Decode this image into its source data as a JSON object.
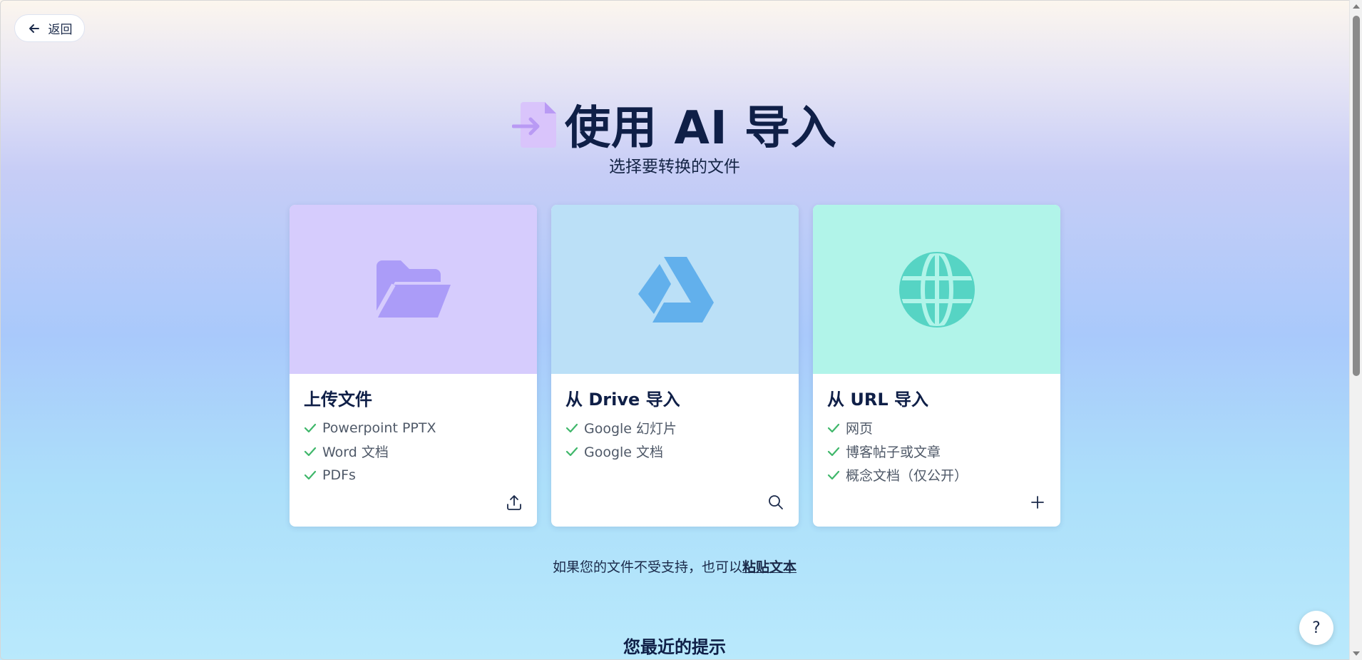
{
  "back": {
    "label": "返回"
  },
  "hero": {
    "title": "使用 AI 导入",
    "subtitle": "选择要转换的文件"
  },
  "cards": [
    {
      "title": "上传文件",
      "bg": "#d6ccfd",
      "icon_color": "#ab9cf8",
      "icon": "folder-icon",
      "action_icon": "upload-icon",
      "features": [
        "Powerpoint PPTX",
        "Word 文档",
        "PDFs"
      ]
    },
    {
      "title": "从 Drive 导入",
      "bg": "#bbe0f7",
      "icon_color": "#62b0ec",
      "icon": "drive-icon",
      "action_icon": "search-icon",
      "features": [
        "Google 幻灯片",
        "Google 文档"
      ]
    },
    {
      "title": "从 URL 导入",
      "bg": "#b1f4e9",
      "icon_color": "#56d4c4",
      "icon": "globe-icon",
      "action_icon": "plus-icon",
      "features": [
        "网页",
        "博客帖子或文章",
        "概念文档（仅公开）"
      ]
    }
  ],
  "paste": {
    "prefix": "如果您的文件不受支持，也可以",
    "link": "粘贴文本"
  },
  "recent": {
    "title": "您最近的提示"
  },
  "help": {
    "label": "?"
  },
  "colors": {
    "check": "#3fb76a",
    "title": "#0f1f47"
  }
}
